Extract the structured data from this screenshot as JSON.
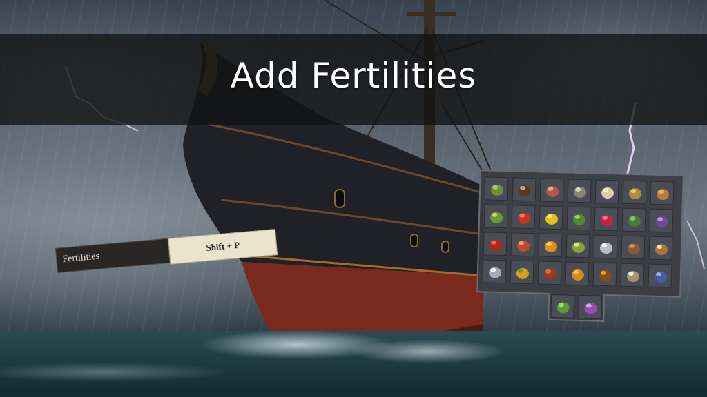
{
  "title": "Add Fertilities",
  "keybind": {
    "label": "Fertilities",
    "key": "Shift + P"
  },
  "inventory": {
    "items": [
      {
        "name": "mushroom-icon",
        "color": "#6b8f3a",
        "accent": "#b5c46a"
      },
      {
        "name": "coconut-icon",
        "color": "#5a3a22",
        "accent": "#c7a070"
      },
      {
        "name": "raw-meat-icon",
        "color": "#b9554a",
        "accent": "#e6a090"
      },
      {
        "name": "oyster-icon",
        "color": "#8a8474",
        "accent": "#d8d2c0"
      },
      {
        "name": "fleece-icon",
        "color": "#d9cdb0",
        "accent": "#f4ecd8"
      },
      {
        "name": "potato-icon",
        "color": "#b38a3c",
        "accent": "#e8c470"
      },
      {
        "name": "bread-icon",
        "color": "#b87a36",
        "accent": "#e7b068"
      },
      {
        "name": "hops-icon",
        "color": "#6e9a30",
        "accent": "#c2d86c"
      },
      {
        "name": "tomato-icon",
        "color": "#c8321e",
        "accent": "#f0735a"
      },
      {
        "name": "banana-icon",
        "color": "#e2c020",
        "accent": "#f8e676"
      },
      {
        "name": "lettuce-icon",
        "color": "#4f8a2a",
        "accent": "#9ccc62"
      },
      {
        "name": "flower-red-icon",
        "color": "#c4233f",
        "accent": "#f07088"
      },
      {
        "name": "herb-icon",
        "color": "#4c7a36",
        "accent": "#8cc070"
      },
      {
        "name": "grapes-icon",
        "color": "#6e4a9a",
        "accent": "#b596d8"
      },
      {
        "name": "chili-icon",
        "color": "#b8241a",
        "accent": "#e86a4a"
      },
      {
        "name": "lobster-icon",
        "color": "#c04a30",
        "accent": "#f09a70"
      },
      {
        "name": "honeycomb-icon",
        "color": "#d89018",
        "accent": "#f6c860"
      },
      {
        "name": "beans-icon",
        "color": "#8aa23a",
        "accent": "#d8e08a"
      },
      {
        "name": "cotton-icon",
        "color": "#b8bcc4",
        "accent": "#eef0f4"
      },
      {
        "name": "fur-pelt-icon",
        "color": "#8a5a30",
        "accent": "#c89060"
      },
      {
        "name": "pot-icon",
        "color": "#a87838",
        "accent": "#f4e0b0"
      },
      {
        "name": "pearls-icon",
        "color": "#a8a8b8",
        "accent": "#f0f0f8"
      },
      {
        "name": "corn-icon",
        "color": "#d8a020",
        "accent": "#6a9a38"
      },
      {
        "name": "spice-icon",
        "color": "#9a3a20",
        "accent": "#d87040"
      },
      {
        "name": "leaf-orange-icon",
        "color": "#d88a20",
        "accent": "#f6c050"
      },
      {
        "name": "cocoa-icon",
        "color": "#8a4a18",
        "accent": "#e0a040"
      },
      {
        "name": "rice-bowl-icon",
        "color": "#a89070",
        "accent": "#f2ead8"
      },
      {
        "name": "grape-blue-icon",
        "color": "#4a5aa8",
        "accent": "#9aa8e8"
      },
      {
        "name": "cactus-flower-icon",
        "color": "#5a9a3a",
        "accent": "#a8d870"
      },
      {
        "name": "orchid-icon",
        "color": "#9a4ab0",
        "accent": "#e0a0f0"
      }
    ]
  }
}
